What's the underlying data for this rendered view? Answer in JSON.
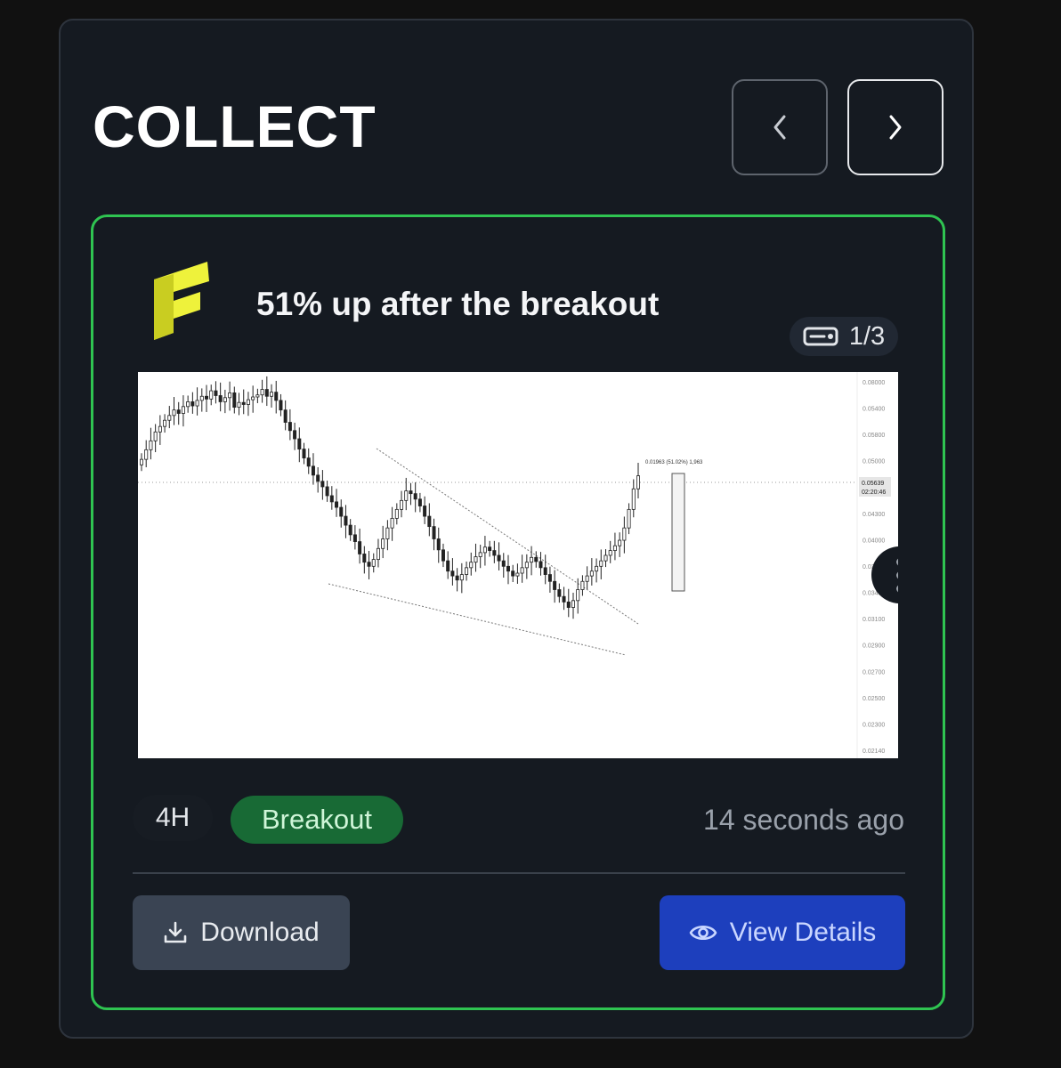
{
  "header": {
    "title": "COLLECT"
  },
  "nav": {
    "prev_icon": "chevron-left-icon",
    "next_icon": "chevron-right-icon"
  },
  "card": {
    "title": "51% up after the breakout",
    "counter": "1/3",
    "timeframe": "4H",
    "tag": "Breakout",
    "time_ago": "14 seconds ago",
    "download_label": "Download",
    "details_label": "View Details"
  },
  "colors": {
    "accent_green": "#2fc451",
    "badge_green": "#186a35",
    "primary_blue": "#1d3fbd",
    "logo_yellow": "#eef23b"
  },
  "chart_data": {
    "type": "candlestick",
    "price_ticks": [
      "0.08000",
      "0.05400",
      "0.05800",
      "0.05000",
      "0.04600",
      "0.04300",
      "0.04000",
      "0.03700",
      "0.03400",
      "0.03100",
      "0.02900",
      "0.02700",
      "0.02500",
      "0.02300",
      "0.02140"
    ],
    "current_price": "0.05639",
    "countdown": "02:20:46",
    "measure_annotation": "0.01963 (51.02%) 1,963",
    "closes": [
      0.0588,
      0.0602,
      0.0615,
      0.0628,
      0.0636,
      0.0645,
      0.0652,
      0.066,
      0.0655,
      0.0665,
      0.0672,
      0.0666,
      0.0674,
      0.068,
      0.0676,
      0.0688,
      0.0681,
      0.0672,
      0.0678,
      0.0685,
      0.0664,
      0.0671,
      0.0668,
      0.0675,
      0.0679,
      0.0682,
      0.069,
      0.068,
      0.0686,
      0.0674,
      0.066,
      0.0642,
      0.063,
      0.0618,
      0.0603,
      0.059,
      0.0578,
      0.0565,
      0.0556,
      0.0548,
      0.0535,
      0.0526,
      0.0518,
      0.0505,
      0.0492,
      0.0478,
      0.0468,
      0.045,
      0.0438,
      0.0432,
      0.0442,
      0.0458,
      0.0472,
      0.0488,
      0.0502,
      0.0515,
      0.0528,
      0.0542,
      0.0538,
      0.053,
      0.052,
      0.0505,
      0.049,
      0.0472,
      0.0456,
      0.044,
      0.0425,
      0.0418,
      0.0412,
      0.042,
      0.043,
      0.0438,
      0.0446,
      0.0452,
      0.046,
      0.0455,
      0.0448,
      0.044,
      0.0432,
      0.0425,
      0.0418,
      0.0422,
      0.043,
      0.0438,
      0.0445,
      0.0439,
      0.043,
      0.042,
      0.041,
      0.0398,
      0.0388,
      0.038,
      0.0372,
      0.0382,
      0.0398,
      0.041,
      0.0418,
      0.0425,
      0.0432,
      0.044,
      0.0448,
      0.0455,
      0.0462,
      0.047,
      0.0488,
      0.0515,
      0.0545,
      0.0564
    ]
  }
}
